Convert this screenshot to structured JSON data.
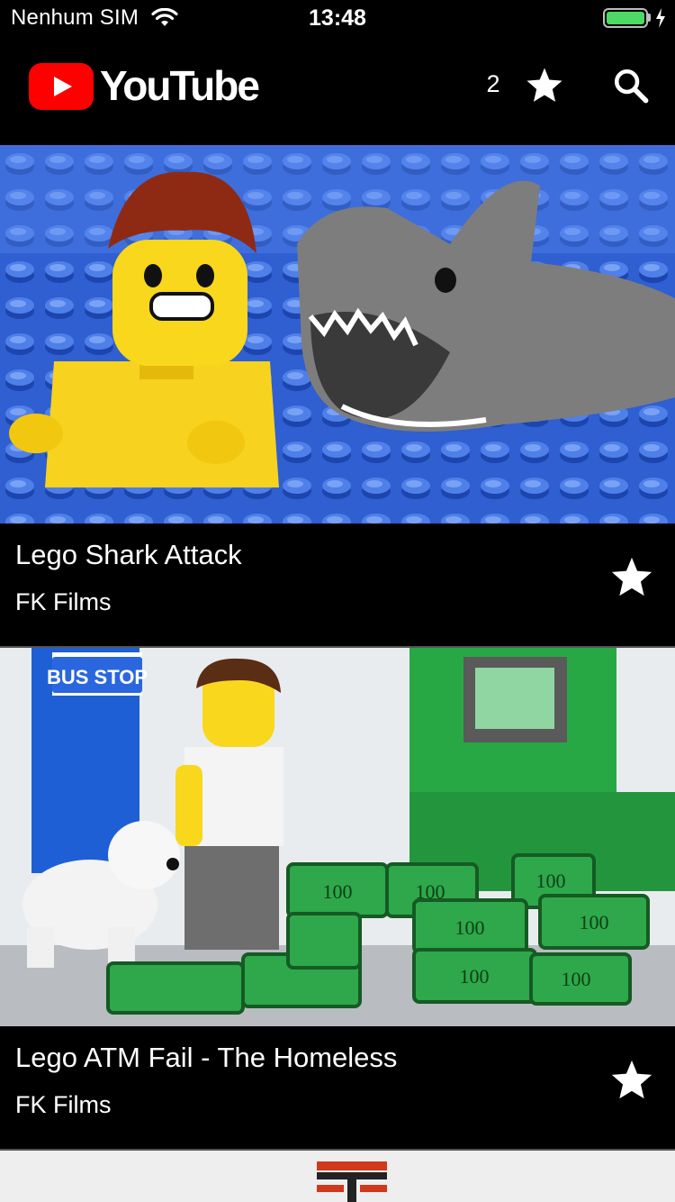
{
  "status_bar": {
    "carrier": "Nenhum SIM",
    "time": "13:48",
    "battery_level": 1.0
  },
  "nav": {
    "logo_text": "YouTube",
    "favorites_count": "2",
    "star_icon": "star-icon",
    "search_icon": "search-icon"
  },
  "videos": [
    {
      "title": "Lego Shark Attack",
      "channel": "FK Films",
      "favorited": true
    },
    {
      "title": "Lego ATM Fail - The Homeless",
      "channel": "FK Films",
      "favorited": true
    }
  ],
  "thumbnail_text": {
    "bus_stop": "BUS STOP",
    "bill": "100"
  },
  "colors": {
    "youtube_red": "#ff0000",
    "background": "#000000",
    "battery_green": "#4cd964"
  }
}
